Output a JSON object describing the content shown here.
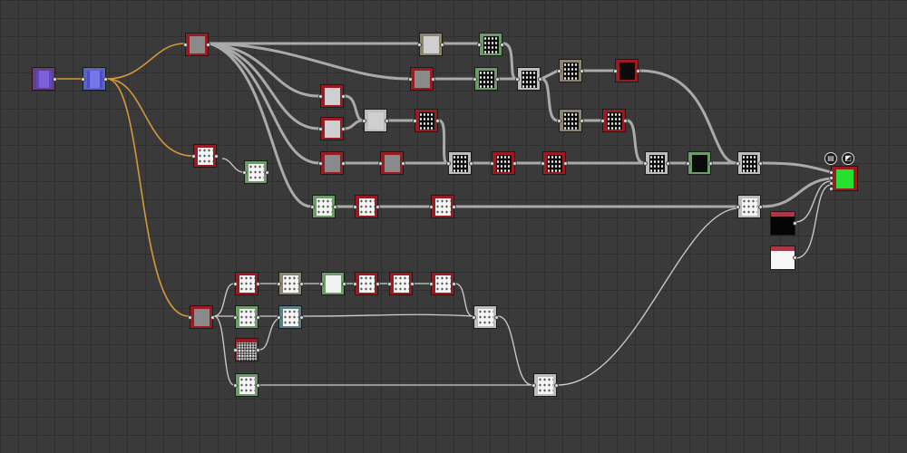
{
  "app": {
    "view": "node-graph"
  },
  "colors": {
    "canvas": "#3a3a3a",
    "wire_gray": "#a9a9a9",
    "wire_orange": "#d4983a",
    "node_red": "#9a1c22",
    "node_green": "#6e9b6a",
    "node_tan": "#8c8670",
    "output_green": "#25e02d"
  },
  "output_node": {
    "icons": [
      "document-icon",
      "checker-icon"
    ]
  }
}
